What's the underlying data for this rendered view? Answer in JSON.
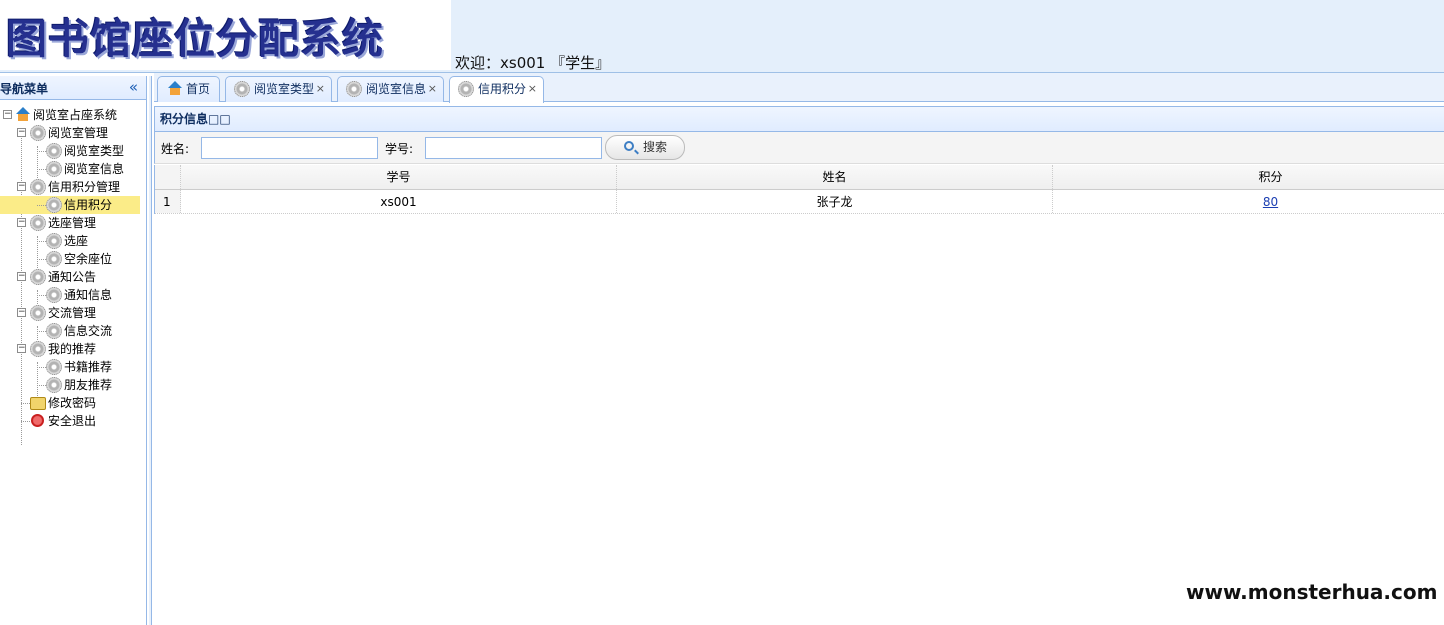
{
  "header": {
    "logo_text": "图书馆座位分配系统",
    "welcome": "欢迎：xs001 『学生』"
  },
  "sidebar": {
    "title": "导航菜单",
    "collapse_icon": "double-chevron-left-icon",
    "tree": [
      {
        "label": "阅览室占座系统",
        "icon": "home-icon"
      },
      {
        "label": "阅览室管理",
        "icon": "gear-icon"
      },
      {
        "label": "阅览室类型",
        "icon": "gear-icon"
      },
      {
        "label": "阅览室信息",
        "icon": "gear-icon"
      },
      {
        "label": "信用积分管理",
        "icon": "gear-icon"
      },
      {
        "label": "信用积分",
        "icon": "gear-icon",
        "selected": true
      },
      {
        "label": "选座管理",
        "icon": "gear-icon"
      },
      {
        "label": "选座",
        "icon": "gear-icon"
      },
      {
        "label": "空余座位",
        "icon": "gear-icon"
      },
      {
        "label": "通知公告",
        "icon": "gear-icon"
      },
      {
        "label": "通知信息",
        "icon": "gear-icon"
      },
      {
        "label": "交流管理",
        "icon": "gear-icon"
      },
      {
        "label": "信息交流",
        "icon": "gear-icon"
      },
      {
        "label": "我的推荐",
        "icon": "gear-icon"
      },
      {
        "label": "书籍推荐",
        "icon": "gear-icon"
      },
      {
        "label": "朋友推荐",
        "icon": "gear-icon"
      },
      {
        "label": "修改密码",
        "icon": "lock-icon"
      },
      {
        "label": "安全退出",
        "icon": "exit-icon"
      }
    ]
  },
  "tabs": [
    {
      "label": "首页",
      "icon": "home-icon",
      "closable": false
    },
    {
      "label": "阅览室类型",
      "icon": "gear-icon",
      "closable": true
    },
    {
      "label": "阅览室信息",
      "icon": "gear-icon",
      "closable": true
    },
    {
      "label": "信用积分",
      "icon": "gear-icon",
      "closable": true,
      "active": true
    }
  ],
  "tab_close_glyph": "×",
  "panel": {
    "title": "积分信息□□"
  },
  "search": {
    "name_label": "姓名:",
    "name_value": "",
    "id_label": "学号:",
    "id_value": "",
    "button_label": "搜索"
  },
  "grid": {
    "columns": [
      "学号",
      "姓名",
      "积分"
    ],
    "rows": [
      {
        "num": "1",
        "student_id": "xs001",
        "name": "张子龙",
        "score": "80"
      }
    ]
  },
  "watermark": "www.monsterhua.com"
}
